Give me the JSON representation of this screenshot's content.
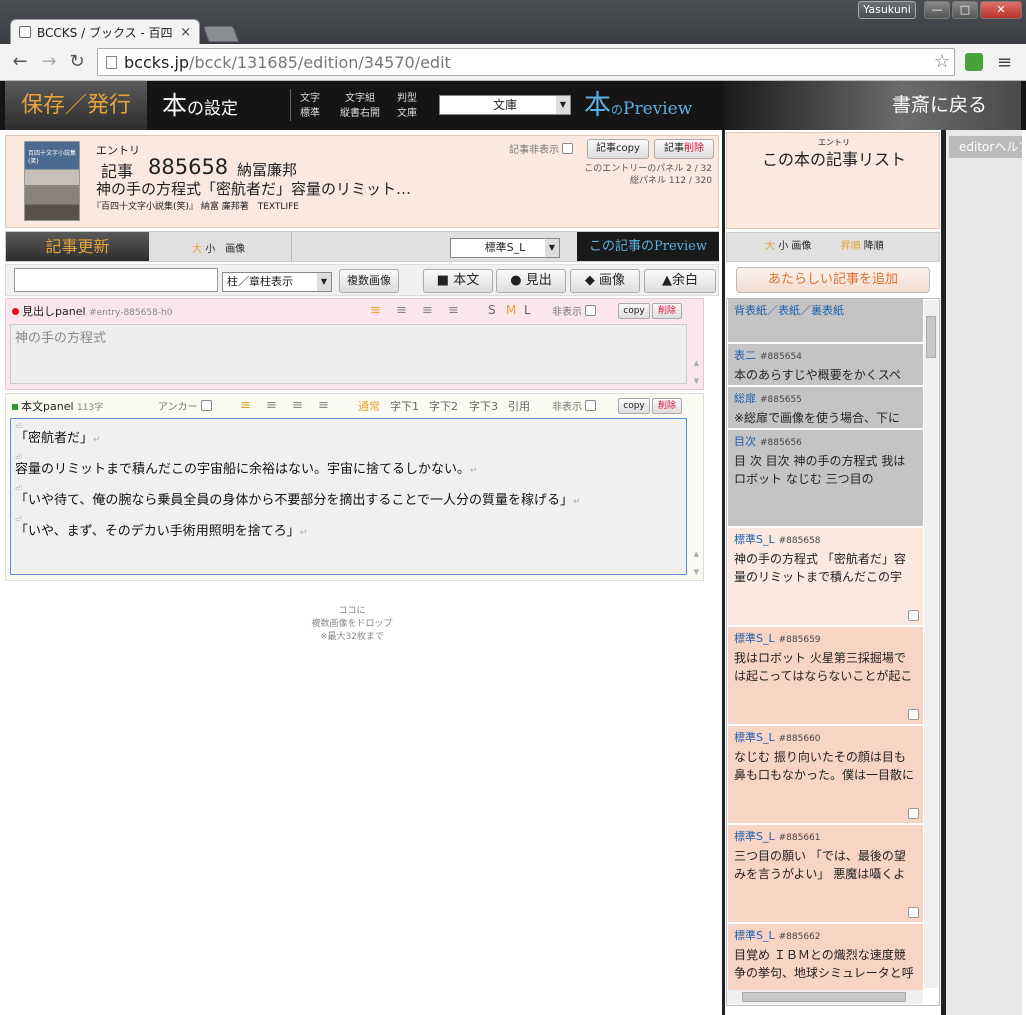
{
  "browser": {
    "tab_title": "BCCKS / ブックス - 百四",
    "tab_close": "×",
    "user": "Yasukuni",
    "url_host": "bccks.jp",
    "url_path": "/bcck/131685/edition/34570/edit",
    "star": "☆",
    "back": "←",
    "forward": "→",
    "reload": "↻",
    "menu": "≡",
    "win_min": "—",
    "win_max": "□",
    "win_close": "✕"
  },
  "header": {
    "save_publish": "保存／発行",
    "book_settings_big": "本",
    "book_settings_rest": "の設定",
    "settings": [
      {
        "label": "文字",
        "value": "標準"
      },
      {
        "label": "文字組",
        "value": "縦書右開"
      },
      {
        "label": "判型",
        "value": "文庫"
      }
    ],
    "format_select": "文庫",
    "preview_big": "本",
    "preview_small": "の",
    "preview_rest": "Preview",
    "back_to_library": "書斎に戻る"
  },
  "entry": {
    "kana": "エントリ",
    "label": "記事",
    "number": "885658",
    "author": "納冨廉邦",
    "title": "神の手の方程式「密航者だ」容量のリミット…",
    "book_line": "『百四十文字小説集(笑)』 納富 廉邦著　TEXTLIFE",
    "thumb_text": "百四十文字小説集(笑)",
    "hide_label": "記事非表示",
    "copy_label": "記事copy",
    "delete_prefix": "記事",
    "delete_label": "削除",
    "panel_line1": "このエントリーのパネル 2 / 32",
    "panel_line2": "総パネル 112 / 320"
  },
  "article_bar": {
    "update": "記事更新",
    "size_large": "大",
    "size_small": "小",
    "size_image": "画像",
    "style_select": "標準S_L",
    "preview": "この記事のPreview"
  },
  "tools": {
    "search_value": "",
    "pillar_select": "柱／章柱表示",
    "multi_image": "複数画像",
    "add_body": "■ 本文",
    "add_heading": "● 見出",
    "add_image": "◆ 画像",
    "add_margin": "▲余白"
  },
  "heading_panel": {
    "label": "見出しpanel",
    "id": "#entry-885658-h0",
    "sizes": [
      "S",
      "M",
      "L"
    ],
    "hide": "非表示",
    "copy": "copy",
    "delete": "削除",
    "text": "神の手の方程式"
  },
  "body_panel": {
    "label": "本文panel",
    "count": "113字",
    "anchor": "アンカー",
    "modes": [
      "通常",
      "字下1",
      "字下2",
      "字下3",
      "引用"
    ],
    "hide": "非表示",
    "copy": "copy",
    "delete": "削除",
    "lines": [
      "「密航者だ」",
      "容量のリミットまで積んだこの宇宙船に余裕はない。宇宙に捨てるしかない。",
      "「いや待て、俺の腕なら乗員全員の身体から不要部分を摘出することで一人分の質量を稼げる」",
      "「いや、まず、そのデカい手術用照明を捨てろ」"
    ],
    "pilcrow": "⏎",
    "linebreak_mark": "↵"
  },
  "drop_note": [
    "ココに",
    "複数画像をドロップ",
    "※最大32枚まで"
  ],
  "list": {
    "ruby": "エントリ",
    "title": "この本の記事リスト",
    "bar_large": "大",
    "bar_small": "小",
    "bar_image": "画像",
    "bar_asc": "昇順",
    "bar_desc": "降順",
    "add_article": "あたらしい記事を追加",
    "items": [
      {
        "type": "背表紙／表紙／裏表紙",
        "id": "",
        "body": ""
      },
      {
        "type": "表二",
        "id": "#885654",
        "body": "本のあらすじや概要をかくスペ"
      },
      {
        "type": "総扉",
        "id": "#885655",
        "body": "※総扉で画像を使う場合、下に"
      },
      {
        "type": "目次",
        "id": "#885656",
        "body": "目 次 目次 神の手の方程式 我はロボット なじむ 三つ目の"
      },
      {
        "type": "標準S_L",
        "id": "#885658",
        "body": "神の手の方程式 「密航者だ」容量のリミットまで積んだこの宇"
      },
      {
        "type": "標準S_L",
        "id": "#885659",
        "body": "我はロボット 火星第三採掘場では起こってはならないことが起こ"
      },
      {
        "type": "標準S_L",
        "id": "#885660",
        "body": "なじむ 振り向いたその顔は目も鼻も口もなかった。僕は一目散に"
      },
      {
        "type": "標準S_L",
        "id": "#885661",
        "body": "三つ目の願い 「では、最後の望みを言うがよい」 悪魔は囁くよ"
      },
      {
        "type": "標準S_L",
        "id": "#885662",
        "body": "目覚め ＩＢＭとの熾烈な速度競争の挙句、地球シミュレータと呼"
      }
    ]
  },
  "editor_help": "editorヘルプ"
}
